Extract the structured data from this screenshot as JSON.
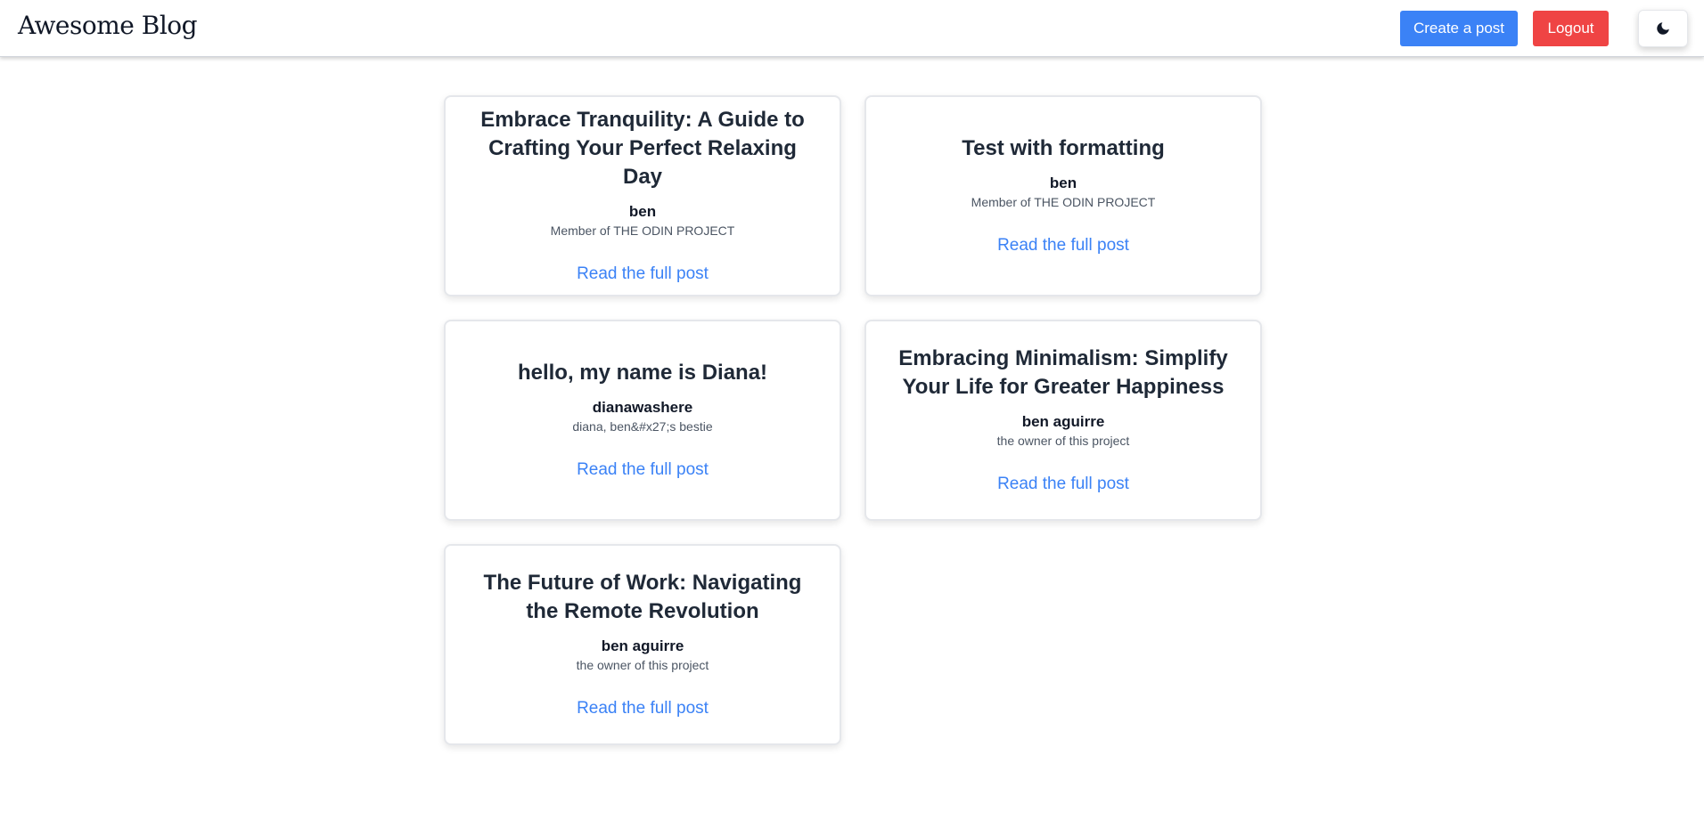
{
  "header": {
    "brand": "Awesome Blog",
    "create_post_label": "Create a post",
    "logout_label": "Logout",
    "theme_toggle_icon": "moon-icon"
  },
  "colors": {
    "primary": "#3b82f6",
    "danger": "#ef4444",
    "link": "#3b82f6"
  },
  "posts": [
    {
      "title": "Embrace Tranquility: A Guide to Crafting Your Perfect Relaxing Day",
      "author": "ben",
      "bio": "Member of THE ODIN PROJECT",
      "link_label": "Read the full post"
    },
    {
      "title": "Test with formatting",
      "author": "ben",
      "bio": "Member of THE ODIN PROJECT",
      "link_label": "Read the full post"
    },
    {
      "title": "hello, my name is Diana!",
      "author": "dianawashere",
      "bio": "diana, ben&#x27;s bestie",
      "link_label": "Read the full post"
    },
    {
      "title": "Embracing Minimalism: Simplify Your Life for Greater Happiness",
      "author": "ben aguirre",
      "bio": "the owner of this project",
      "link_label": "Read the full post"
    },
    {
      "title": "The Future of Work: Navigating the Remote Revolution",
      "author": "ben aguirre",
      "bio": "the owner of this project",
      "link_label": "Read the full post"
    }
  ]
}
